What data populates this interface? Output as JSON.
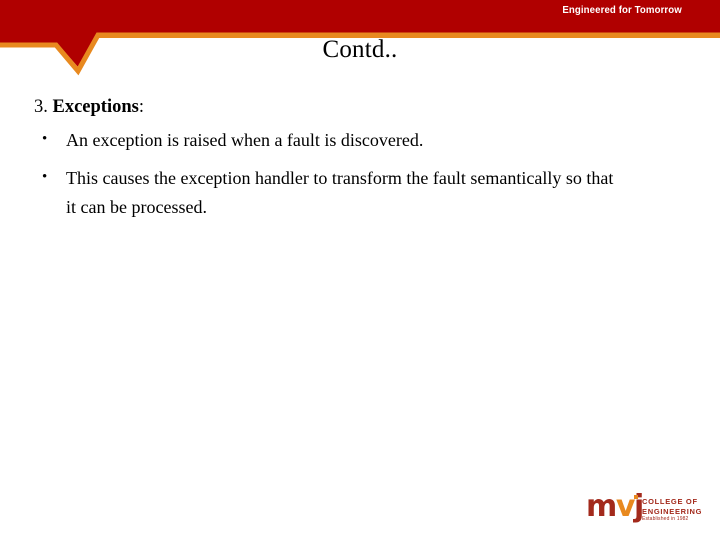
{
  "slide": {
    "title": "Contd..",
    "tagline": "Engineered for Tomorrow",
    "section": {
      "number": "3. ",
      "term": "Exceptions",
      "colon": ":"
    },
    "bullets": [
      {
        "marker": "•",
        "text": "An exception is raised when a fault is discovered."
      },
      {
        "marker": "•",
        "text": "This causes the exception handler to transform the fault semantically so that it can be processed."
      }
    ]
  },
  "logo": {
    "mark_m": "m",
    "mark_v": "v",
    "mark_j": "j",
    "line1": "COLLEGE OF",
    "line2": "ENGINEERING",
    "line3": "Established in 1982"
  },
  "colors": {
    "banner_red": "#b00000",
    "accent_orange": "#e8891f",
    "logo_red": "#a32a1c",
    "text_black": "#000000",
    "background": "#ffffff"
  }
}
